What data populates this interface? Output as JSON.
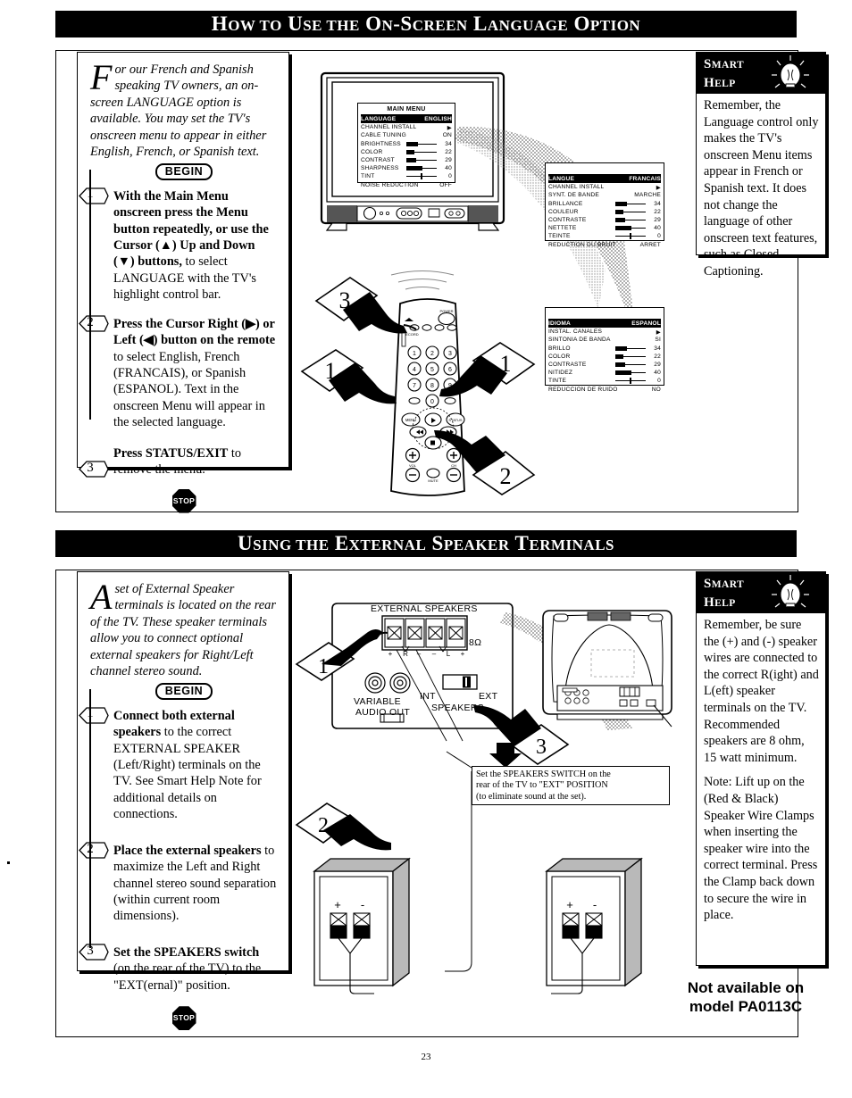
{
  "page": {
    "number": "23",
    "not_available_note": [
      "Not available on",
      "model PA0113C"
    ]
  },
  "sections": [
    {
      "id": "language",
      "banner": "How to Use the On-Screen Language Option",
      "intro": {
        "dropcap": "F",
        "text": "or our French and Spanish speaking TV owners, an on-screen LANGUAGE option is available. You may set the TV's onscreen menu to appear in either English, French, or Spanish text."
      },
      "begin_label": "BEGIN",
      "stop_label": "STOP",
      "steps": [
        {
          "num": "1",
          "bold": "With the Main Menu onscreen press the Menu button repeatedly, or use the Cursor (▲) Up and Down (▼) buttons,",
          "rest": " to select LANGUAGE with the TV's highlight control bar."
        },
        {
          "num": "2",
          "bold": "Press the Cursor Right (▶) or Left (◀) button on the remote",
          "rest": " to select English, French (FRANCAIS), or Spanish (ESPANOL). Text in the onscreen Menu will appear in the selected language."
        },
        {
          "num": "3",
          "bold": "Press STATUS/EXIT",
          "rest": " to remove the menu."
        }
      ],
      "smart_help": {
        "title_line1": "Smart",
        "title_line2": "Help",
        "paragraphs": [
          "Remember, the Language control only makes the TV's onscreen Menu items appear in French or Spanish text. It does not change the language of other onscreen text features, such as Closed Captioning."
        ]
      },
      "callouts": {
        "remote_markers": [
          "3",
          "1",
          "1",
          "2"
        ]
      }
    },
    {
      "id": "speakers",
      "banner": "Using the External Speaker Terminals",
      "intro": {
        "dropcap": "A",
        "text": " set of External Speaker terminals is located on the rear of the TV. These speaker terminals allow you to connect optional external speakers for Right/Left channel stereo sound."
      },
      "begin_label": "BEGIN",
      "stop_label": "STOP",
      "steps": [
        {
          "num": "1",
          "bold": "Connect both external speakers",
          "rest": " to the correct EXTERNAL SPEAKER (Left/Right) terminals on the TV. See Smart Help Note for additional details on connections."
        },
        {
          "num": "2",
          "bold": "Place the external speakers",
          "rest": " to maximize the Left and Right channel stereo sound separation (within current room dimensions)."
        },
        {
          "num": "3",
          "bold": "Set the SPEAKERS switch",
          "rest": " (on the rear of the TV) to the \"EXT(ernal)\" position."
        }
      ],
      "smart_help": {
        "title_line1": "Smart",
        "title_line2": "Help",
        "paragraphs": [
          "Remember, be sure the (+) and (-) speaker wires are connected to the correct R(ight) and L(eft) speaker terminals on the TV. Recommended speakers are 8 ohm, 15 watt minimum.",
          "Note: Lift up on the (Red & Black) Speaker Wire Clamps when inserting the speaker wire into the correct terminal. Press the Clamp back down to secure the wire in place."
        ]
      },
      "diagram": {
        "terminals_title": "EXTERNAL SPEAKERS",
        "impedance": "8Ω",
        "polarity": [
          "+",
          "R",
          "–",
          "–",
          "L",
          "+"
        ],
        "variable_audio_out": [
          "VARIABLE",
          "AUDIO OUT"
        ],
        "switch_left": "INT",
        "switch_right": "EXT",
        "switch_label": "SPEAKERS",
        "marker_1": "1",
        "marker_2": "2",
        "marker_3": "3",
        "speaker_terminal_plus": "+",
        "speaker_terminal_minus": "-",
        "callout": [
          "Set the SPEAKERS SWITCH on the",
          "rear of the TV to \"EXT\" POSITION",
          "(to eliminate sound at the set)."
        ]
      }
    }
  ],
  "osd_menus": {
    "english": {
      "title": "MAIN MENU",
      "rows": [
        {
          "label": "LANGUAGE",
          "value": "ENGLISH",
          "highlight": true
        },
        {
          "label": "CHANNEL INSTALL",
          "value": "▶"
        },
        {
          "label": "CABLE TUNING",
          "value": "ON"
        },
        {
          "label": "BRIGHTNESS",
          "value": "34",
          "bar": 38
        },
        {
          "label": "COLOR",
          "value": "22",
          "bar": 26
        },
        {
          "label": "CONTRAST",
          "value": "29",
          "bar": 33
        },
        {
          "label": "SHARPNESS",
          "value": "40",
          "bar": 52
        },
        {
          "label": "TINT",
          "value": "0",
          "center": true
        },
        {
          "label": "NOISE REDUCTION",
          "value": "OFF"
        }
      ]
    },
    "french": {
      "title": "",
      "rows": [
        {
          "label": "LANGUE",
          "value": "FRANCAIS",
          "highlight": true
        },
        {
          "label": "CHANNEL INSTALL",
          "value": "▶"
        },
        {
          "label": "SYNT. DE BANDE",
          "value": "MARCHE"
        },
        {
          "label": "BRILLANCE",
          "value": "34",
          "bar": 38
        },
        {
          "label": "COULEUR",
          "value": "22",
          "bar": 26
        },
        {
          "label": "CONTRASTE",
          "value": "29",
          "bar": 33
        },
        {
          "label": "NETTETE",
          "value": "40",
          "bar": 52
        },
        {
          "label": "TEINTE",
          "value": "0",
          "center": true
        },
        {
          "label": "REDUCTION DU BRUIT",
          "value": "ARRET"
        }
      ]
    },
    "spanish": {
      "title": "",
      "rows": [
        {
          "label": "IDIOMA",
          "value": "ESPANOL",
          "highlight": true
        },
        {
          "label": "INSTAL. CANALES",
          "value": "▶"
        },
        {
          "label": "SINTONIA DE BANDA",
          "value": "SI"
        },
        {
          "label": "BRILLO",
          "value": "34",
          "bar": 38
        },
        {
          "label": "COLOR",
          "value": "22",
          "bar": 26
        },
        {
          "label": "CONTRASTE",
          "value": "29",
          "bar": 33
        },
        {
          "label": "NITIDEZ",
          "value": "40",
          "bar": 52
        },
        {
          "label": "TINTE",
          "value": "0",
          "center": true
        },
        {
          "label": "REDUCCION DE RUIDO",
          "value": "NO"
        }
      ]
    }
  },
  "remote": {
    "keys": [
      "1",
      "2",
      "3",
      "4",
      "5",
      "6",
      "7",
      "8",
      "9",
      "0"
    ],
    "power_label": "POWER"
  },
  "colors": {
    "ink": "#000000",
    "paper": "#ffffff",
    "screen_fill": "#ffffff"
  }
}
